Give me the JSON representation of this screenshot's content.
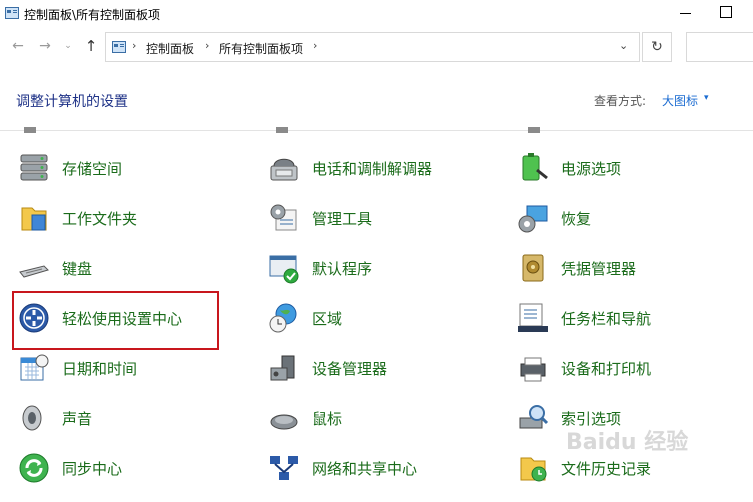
{
  "window": {
    "title": "控制面板\\所有控制面板项"
  },
  "address": {
    "crumbs": [
      "控制面板",
      "所有控制面板项"
    ],
    "separator": "›"
  },
  "header": {
    "title": "调整计算机的设置",
    "view_by_label": "查看方式:",
    "view_by_value": "大图标",
    "view_by_caret": "▾"
  },
  "nav": {
    "back": "←",
    "forward": "→",
    "recent": "⌄",
    "up": "↑",
    "dropdown": "⌄",
    "refresh": "↻"
  },
  "items": [
    {
      "label": "存储空间",
      "icon": "storage-icon"
    },
    {
      "label": "电话和调制解调器",
      "icon": "phone-modem-icon"
    },
    {
      "label": "电源选项",
      "icon": "power-options-icon"
    },
    {
      "label": "工作文件夹",
      "icon": "work-folders-icon"
    },
    {
      "label": "管理工具",
      "icon": "admin-tools-icon"
    },
    {
      "label": "恢复",
      "icon": "recovery-icon"
    },
    {
      "label": "键盘",
      "icon": "keyboard-icon"
    },
    {
      "label": "默认程序",
      "icon": "default-programs-icon"
    },
    {
      "label": "凭据管理器",
      "icon": "credential-manager-icon"
    },
    {
      "label": "轻松使用设置中心",
      "icon": "ease-of-access-icon"
    },
    {
      "label": "区域",
      "icon": "region-icon"
    },
    {
      "label": "任务栏和导航",
      "icon": "taskbar-icon"
    },
    {
      "label": "日期和时间",
      "icon": "date-time-icon"
    },
    {
      "label": "设备管理器",
      "icon": "device-manager-icon"
    },
    {
      "label": "设备和打印机",
      "icon": "devices-printers-icon"
    },
    {
      "label": "声音",
      "icon": "sound-icon"
    },
    {
      "label": "鼠标",
      "icon": "mouse-icon"
    },
    {
      "label": "索引选项",
      "icon": "indexing-icon"
    },
    {
      "label": "同步中心",
      "icon": "sync-center-icon"
    },
    {
      "label": "网络和共享中心",
      "icon": "network-sharing-icon"
    },
    {
      "label": "文件历史记录",
      "icon": "file-history-icon"
    }
  ],
  "watermark": "Baidu 经验"
}
